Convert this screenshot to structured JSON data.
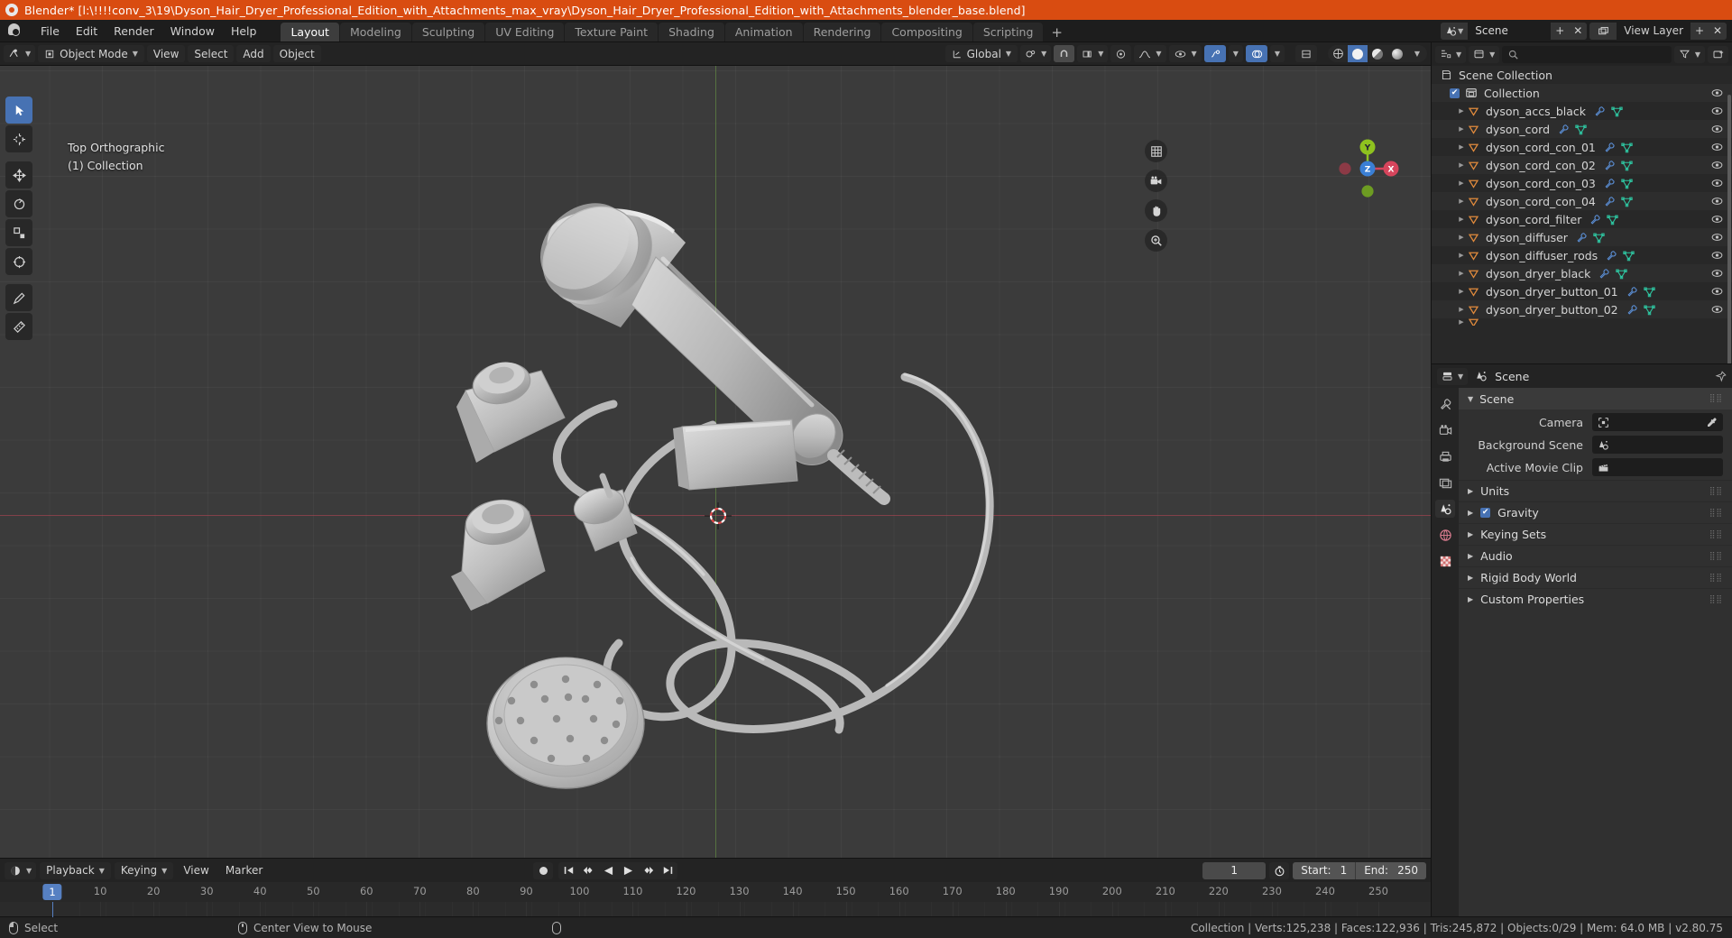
{
  "titlebar": {
    "app": "Blender*",
    "path": "[l:\\!!!!conv_3\\19\\Dyson_Hair_Dryer_Professional_Edition_with_Attachments_max_vray\\Dyson_Hair_Dryer_Professional_Edition_with_Attachments_blender_base.blend]",
    "full": "Blender* [l:\\!!!!conv_3\\19\\Dyson_Hair_Dryer_Professional_Edition_with_Attachments_max_vray\\Dyson_Hair_Dryer_Professional_Edition_with_Attachments_blender_base.blend]",
    "logo_icon": "blender-logo-icon",
    "accent_color": "#d94c11"
  },
  "topbar": {
    "menus": [
      "File",
      "Edit",
      "Render",
      "Window",
      "Help"
    ],
    "workspaces": [
      {
        "label": "Layout",
        "active": true
      },
      {
        "label": "Modeling",
        "active": false
      },
      {
        "label": "Sculpting",
        "active": false
      },
      {
        "label": "UV Editing",
        "active": false
      },
      {
        "label": "Texture Paint",
        "active": false
      },
      {
        "label": "Shading",
        "active": false
      },
      {
        "label": "Animation",
        "active": false
      },
      {
        "label": "Rendering",
        "active": false
      },
      {
        "label": "Compositing",
        "active": false
      },
      {
        "label": "Scripting",
        "active": false
      }
    ],
    "add_workspace_label": "+",
    "scene_name": "Scene",
    "scene_icon": "scene-icon",
    "new_scene_label": "+",
    "unlink_scene_label": "✕",
    "view_layer_name": "View Layer",
    "view_layer_icon": "viewlayer-icon"
  },
  "viewport": {
    "editor_type_icon": "editor-type-icon",
    "mode": "Object Mode",
    "mode_icon": "object-mode-icon",
    "menus": [
      "View",
      "Select",
      "Add",
      "Object"
    ],
    "transform_orientation": "Global",
    "transform_icon": "orientation-icon",
    "snap_icon": "snap-magnet-icon",
    "proportional_icon": "proportional-edit-icon",
    "pivot_icon": "pivot-point-icon",
    "falloff_icon": "falloff-curve-icon",
    "overlay_icon": "overlays-icon",
    "xray_icon": "xray-icon",
    "visibility_icon": "visibility-icon",
    "gizmo_icon": "gizmo-icon",
    "info_line_1": "Top Orthographic",
    "info_line_2": "(1) Collection",
    "nav_icons": [
      "grid-toggle-icon",
      "camera-view-icon",
      "pan-hand-icon",
      "zoom-magnifier-icon"
    ],
    "gizmo_axes": [
      {
        "label": "Y",
        "color": "#8ec21f"
      },
      {
        "label": "Z",
        "color": "#3a7fd5"
      },
      {
        "label": "X",
        "color": "#d6455c"
      }
    ],
    "shading_modes": [
      "wireframe-shading-icon",
      "solid-shading-icon",
      "material-preview-icon",
      "rendered-shading-icon"
    ],
    "active_shading": "solid-shading-icon",
    "tools": [
      {
        "name": "tweak-select-tool",
        "icon": "cursor-arrow-icon",
        "active": true
      },
      {
        "name": "cursor-tool",
        "icon": "3d-cursor-icon",
        "active": false
      },
      {
        "name": "move-tool",
        "icon": "move-arrows-icon",
        "active": false
      },
      {
        "name": "rotate-tool",
        "icon": "rotate-circle-icon",
        "active": false
      },
      {
        "name": "scale-tool",
        "icon": "scale-square-icon",
        "active": false
      },
      {
        "name": "transform-tool",
        "icon": "transform-icon",
        "active": false
      },
      {
        "name": "annotate-tool",
        "icon": "pencil-icon",
        "active": false
      },
      {
        "name": "measure-tool",
        "icon": "ruler-icon",
        "active": false
      }
    ]
  },
  "timeline": {
    "editor_icon": "timeline-editor-icon",
    "menus": [
      "Playback",
      "Keying",
      "View",
      "Marker"
    ],
    "record_icon": "auto-keying-record-icon",
    "transport": [
      "jump-to-start-icon",
      "jump-to-prev-keyframe-icon",
      "play-reverse-icon",
      "play-icon",
      "jump-to-next-keyframe-icon",
      "jump-to-end-icon"
    ],
    "current_frame": "1",
    "current_frame_icon": "use-preview-range-icon",
    "start_label": "Start:",
    "start_value": "1",
    "end_label": "End:",
    "end_value": "250",
    "playhead_label": "1",
    "ticks": [
      "1",
      "10",
      "20",
      "30",
      "40",
      "50",
      "60",
      "70",
      "80",
      "90",
      "100",
      "110",
      "120",
      "130",
      "140",
      "150",
      "160",
      "170",
      "180",
      "190",
      "200",
      "210",
      "220",
      "230",
      "240",
      "250"
    ]
  },
  "outliner": {
    "display_mode_icon": "outliner-display-mode-icon",
    "filter_icon": "filter-icon",
    "search_placeholder": "",
    "search_icon": "search-icon",
    "new_collection_icon": "new-collection-icon",
    "root": "Scene Collection",
    "root_icon": "scene-collection-icon",
    "collection": {
      "label": "Collection",
      "icon": "collection-icon",
      "checked": true
    },
    "items": [
      {
        "label": "dyson_accs_black",
        "icon": "mesh-data-icon",
        "modifier": true,
        "mesh": true
      },
      {
        "label": "dyson_cord",
        "icon": "mesh-data-icon",
        "modifier": true,
        "mesh": true
      },
      {
        "label": "dyson_cord_con_01",
        "icon": "mesh-data-icon",
        "modifier": true,
        "mesh": true
      },
      {
        "label": "dyson_cord_con_02",
        "icon": "mesh-data-icon",
        "modifier": true,
        "mesh": true
      },
      {
        "label": "dyson_cord_con_03",
        "icon": "mesh-data-icon",
        "modifier": true,
        "mesh": true
      },
      {
        "label": "dyson_cord_con_04",
        "icon": "mesh-data-icon",
        "modifier": true,
        "mesh": true
      },
      {
        "label": "dyson_cord_filter",
        "icon": "mesh-data-icon",
        "modifier": true,
        "mesh": true
      },
      {
        "label": "dyson_diffuser",
        "icon": "mesh-data-icon",
        "modifier": true,
        "mesh": true
      },
      {
        "label": "dyson_diffuser_rods",
        "icon": "mesh-data-icon",
        "modifier": true,
        "mesh": true
      },
      {
        "label": "dyson_dryer_black",
        "icon": "mesh-data-icon",
        "modifier": true,
        "mesh": true
      },
      {
        "label": "dyson_dryer_button_01",
        "icon": "mesh-data-icon",
        "modifier": true,
        "mesh": true
      },
      {
        "label": "dyson_dryer_button_02",
        "icon": "mesh-data-icon",
        "modifier": true,
        "mesh": true
      }
    ],
    "eye_icon": "eye-visibility-icon"
  },
  "properties": {
    "editor_icon": "properties-editor-icon",
    "breadcrumb": "Scene",
    "breadcrumb_icon": "scene-props-icon",
    "pin_icon": "pin-icon",
    "tabs": [
      {
        "name": "tool-tab",
        "icon": "tool-wrench-icon",
        "active": false
      },
      {
        "name": "render-tab",
        "icon": "render-camera-icon",
        "active": false
      },
      {
        "name": "output-tab",
        "icon": "output-printer-icon",
        "active": false
      },
      {
        "name": "view-layer-tab",
        "icon": "view-layer-images-icon",
        "active": false
      },
      {
        "name": "scene-tab",
        "icon": "scene-cone-icon",
        "active": true
      },
      {
        "name": "world-tab",
        "icon": "world-globe-icon",
        "active": false
      },
      {
        "name": "texture-tab",
        "icon": "texture-checker-icon",
        "active": false
      }
    ],
    "panel_title": "Scene",
    "rows": [
      {
        "label": "Camera",
        "value": "",
        "icon": "camera-object-icon",
        "eyedropper": true
      },
      {
        "label": "Background Scene",
        "value": "",
        "icon": "scene-props-icon",
        "eyedropper": false
      },
      {
        "label": "Active Movie Clip",
        "value": "",
        "icon": "movie-clip-icon",
        "eyedropper": false
      }
    ],
    "accordions": [
      {
        "label": "Units",
        "checkbox": null
      },
      {
        "label": "Gravity",
        "checkbox": true
      },
      {
        "label": "Keying Sets",
        "checkbox": null
      },
      {
        "label": "Audio",
        "checkbox": null
      },
      {
        "label": "Rigid Body World",
        "checkbox": null
      },
      {
        "label": "Custom Properties",
        "checkbox": null
      }
    ]
  },
  "statusbar": {
    "hints": [
      {
        "icon": "mouse-left-icon",
        "label": "Select"
      },
      {
        "icon": "mouse-middle-icon",
        "label": "Center View to Mouse"
      },
      {
        "icon": "mouse-right-icon",
        "label": ""
      }
    ],
    "stats": "Collection | Verts:125,238 | Faces:122,936 | Tris:245,872 | Objects:0/29 | Mem: 64.0 MB | v2.80.75"
  }
}
